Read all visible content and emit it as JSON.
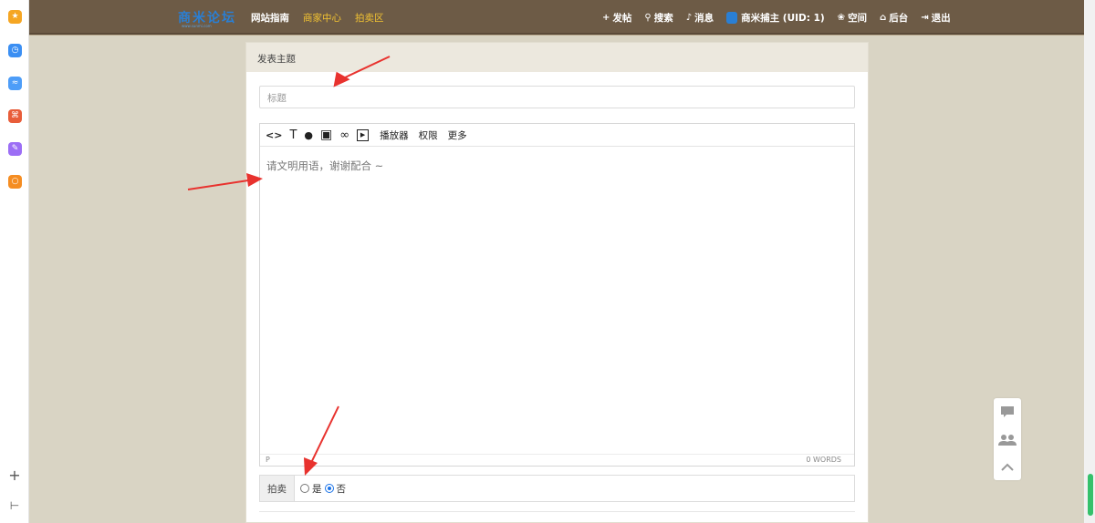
{
  "browser_sidebar": {
    "icons": [
      {
        "name": "favorites-icon",
        "color": "#f5a623",
        "glyph": "★"
      },
      {
        "name": "history-icon",
        "color": "#3b8ff3",
        "glyph": "◷"
      },
      {
        "name": "chart-app-icon",
        "color": "#4d9df8",
        "glyph": "≈"
      },
      {
        "name": "pdf-icon",
        "color": "#e85d3a",
        "glyph": "⌘"
      },
      {
        "name": "note-icon",
        "color": "#9c6ef5",
        "glyph": "✎"
      },
      {
        "name": "search-app-icon",
        "color": "#f58d22",
        "glyph": "○"
      }
    ],
    "add_glyph": "+",
    "collapse_glyph": "⊢"
  },
  "navbar": {
    "logo_text": "商米论坛",
    "logo_sub": "www.sunmi.com",
    "links": [
      "网站指南",
      "商家中心",
      "拍卖区"
    ],
    "right_items": [
      {
        "icon": "plus-icon",
        "glyph": "+",
        "label": "发帖"
      },
      {
        "icon": "search-icon",
        "glyph": "⚲",
        "label": "搜索"
      },
      {
        "icon": "bell-icon",
        "glyph": "♪",
        "label": "消息"
      },
      {
        "icon": "user-avatar",
        "glyph": "",
        "label": "商米捕主 (UID: 1)"
      },
      {
        "icon": "paw-icon",
        "glyph": "❀",
        "label": "空间"
      },
      {
        "icon": "home-icon",
        "glyph": "⌂",
        "label": "后台"
      },
      {
        "icon": "logout-icon",
        "glyph": "⇥",
        "label": "退出"
      }
    ]
  },
  "panel": {
    "heading": "发表主题",
    "title_placeholder": "标题",
    "toolbar": {
      "icons": [
        {
          "name": "code-icon",
          "glyph": "<>"
        },
        {
          "name": "text-format-icon",
          "glyph": "T"
        },
        {
          "name": "color-drop-icon",
          "glyph": "●"
        },
        {
          "name": "image-icon",
          "glyph": "▣"
        },
        {
          "name": "link-icon",
          "glyph": "∞"
        },
        {
          "name": "video-icon",
          "glyph": "▶"
        }
      ],
      "text_buttons": [
        "播放器",
        "权限",
        "更多"
      ]
    },
    "editor_placeholder": "请文明用语，谢谢配合 ~",
    "status_left": "P",
    "status_right": "0 WORDS",
    "auction": {
      "label": "拍卖",
      "options": [
        {
          "label": "是",
          "checked": false
        },
        {
          "label": "否",
          "checked": true
        }
      ]
    }
  },
  "float_tools": [
    {
      "name": "comment-icon",
      "glyph": "▰"
    },
    {
      "name": "users-icon",
      "glyph": "◍◍"
    },
    {
      "name": "back-to-top-icon",
      "glyph": "⌃"
    }
  ],
  "colors": {
    "navbar": "#6d5b46",
    "nav_highlight": "#f1c232",
    "page_bg": "#d9d4c4",
    "annotation": "#e8322e"
  }
}
